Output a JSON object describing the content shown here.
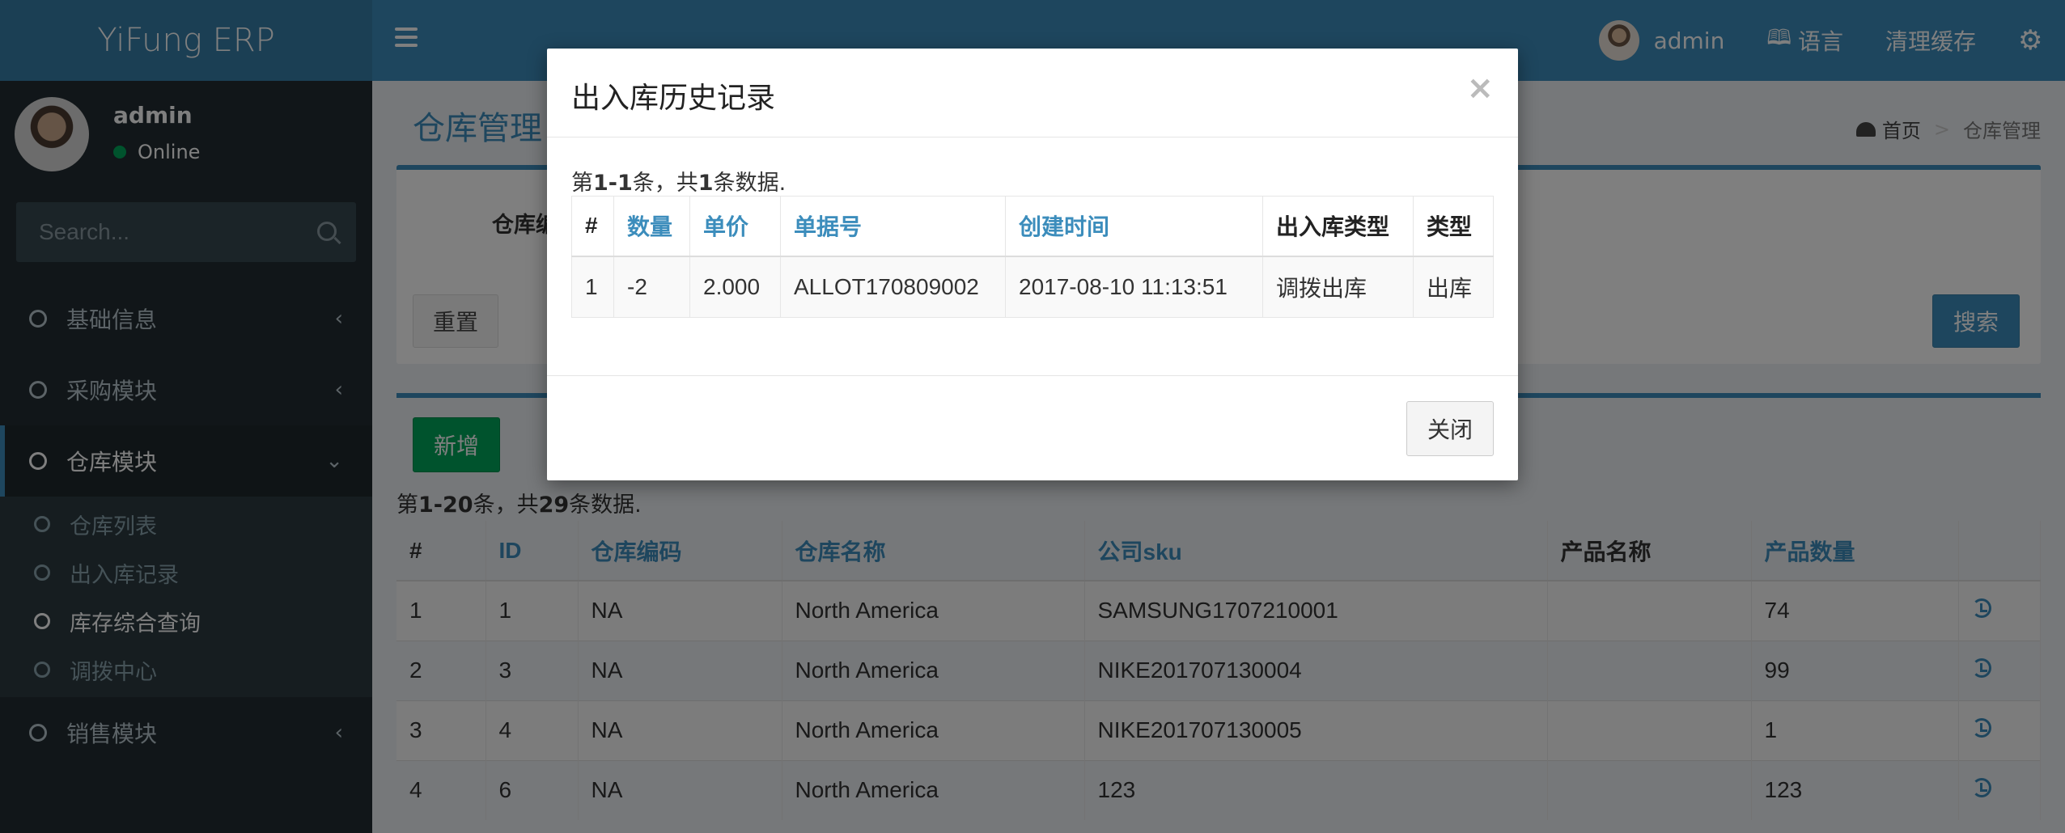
{
  "header": {
    "logo": "YiFung ERP",
    "user": "admin",
    "language": "语言",
    "clear_cache": "清理缓存"
  },
  "sidebar": {
    "user_name": "admin",
    "status": "Online",
    "search_placeholder": "Search...",
    "menu": [
      {
        "label": "基础信息"
      },
      {
        "label": "采购模块"
      },
      {
        "label": "仓库模块"
      },
      {
        "label": "销售模块"
      }
    ],
    "submenu": [
      {
        "label": "仓库列表"
      },
      {
        "label": "出入库记录"
      },
      {
        "label": "库存综合查询"
      },
      {
        "label": "调拨中心"
      }
    ]
  },
  "content": {
    "page_title": "仓库管理",
    "breadcrumb_home": "首页",
    "breadcrumb_current": "仓库管理",
    "filter_label": "仓库编",
    "reset": "重置",
    "search": "搜索",
    "add": "新增",
    "summary": {
      "prefix": "第",
      "range": "1-20",
      "mid": "条，共",
      "total": "29",
      "suffix": "条数据."
    },
    "table": {
      "headers": [
        "#",
        "ID",
        "仓库编码",
        "仓库名称",
        "公司sku",
        "产品名称",
        "产品数量"
      ],
      "rows": [
        [
          "1",
          "1",
          "NA",
          "North America",
          "SAMSUNG1707210001",
          "",
          "74"
        ],
        [
          "2",
          "3",
          "NA",
          "North America",
          "NIKE201707130004",
          "",
          "99"
        ],
        [
          "3",
          "4",
          "NA",
          "North America",
          "NIKE201707130005",
          "",
          "1"
        ],
        [
          "4",
          "6",
          "NA",
          "North America",
          "123",
          "",
          "123"
        ]
      ]
    }
  },
  "modal": {
    "title": "出入库历史记录",
    "close_x": "×",
    "summary": {
      "prefix": "第",
      "range": "1-1",
      "mid": "条，共",
      "total": "1",
      "suffix": "条数据."
    },
    "headers": [
      "#",
      "数量",
      "单价",
      "单据号",
      "创建时间",
      "出入库类型",
      "类型"
    ],
    "rows": [
      [
        "1",
        "-2",
        "2.000",
        "ALLOT170809002",
        "2017-08-10 11:13:51",
        "调拨出库",
        "出库"
      ]
    ],
    "close_button": "关闭"
  }
}
